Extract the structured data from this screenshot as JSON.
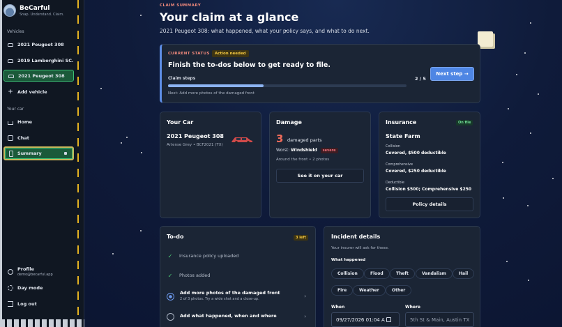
{
  "sidebar": {
    "brand": {
      "name": "BeCarful",
      "tagline": "Snap. Understand. Claim."
    },
    "vehicles_label": "Vehicles",
    "vehicles": [
      "2021 Peugeot 308",
      "2019 Lamborghini SC...",
      "2021 Peugeot 308"
    ],
    "add_vehicle": "Add vehicle",
    "your_car_label": "Your car",
    "nav": [
      "Home",
      "Chat",
      "Summary"
    ],
    "profile": {
      "label": "Profile",
      "email": "demo@becarful.app"
    },
    "day_mode": "Day mode",
    "logout": "Log out"
  },
  "header": {
    "eyebrow": "CLAIM SUMMARY",
    "title": "Your claim at a glance",
    "subtitle": "2021 Peugeot 308: what happened, what your policy says, and what to do next."
  },
  "status": {
    "label": "CURRENT STATUS",
    "badge": "Action needed",
    "headline": "Finish the to-dos below to get ready to file.",
    "steps_label": "Claim steps",
    "steps_count": "2 / 5",
    "progress": 0.4,
    "next_text": "Next: Add more photos of the damaged front",
    "next_button": "Next step →"
  },
  "car": {
    "title": "Your Car",
    "name": "2021 Peugeot 308",
    "meta": "Artense Grey • BCF2021 (TX)"
  },
  "damage": {
    "title": "Damage",
    "count": "3",
    "parts_label": "damaged parts",
    "worst_label": "Worst:",
    "worst_part": "Windshield",
    "severity": "severe",
    "where": "Around the front • 2 photos",
    "button": "See it on your car"
  },
  "insurance": {
    "title": "Insurance",
    "badge": "On file",
    "insurer": "State Farm",
    "coverages": [
      {
        "label": "Collision",
        "value": "Covered, $500 deductible"
      },
      {
        "label": "Comprehensive",
        "value": "Covered, $250 deductible"
      },
      {
        "label": "Deductible",
        "value": "Collision $500; Comprehensive $250"
      }
    ],
    "button": "Policy details"
  },
  "todo": {
    "title": "To-do",
    "badge": "3 left",
    "items": [
      {
        "label": "Insurance policy uploaded",
        "sub": ""
      },
      {
        "label": "Photos added",
        "sub": ""
      },
      {
        "label": "Add more photos of the damaged front",
        "sub": "2 of 3 photos. Try a wide shot and a close-up."
      },
      {
        "label": "Add what happened, when and where",
        "sub": ""
      }
    ]
  },
  "incident": {
    "title": "Incident details",
    "subtitle": "Your insurer will ask for these.",
    "what_label": "What happened",
    "options": [
      "Collision",
      "Flood",
      "Theft",
      "Vandalism",
      "Hail",
      "Fire",
      "Weather",
      "Other"
    ],
    "when_label": "When",
    "when_value": "09/27/2026 01:04 A",
    "where_label": "Where",
    "where_placeholder": "5th St & Main, Austin TX"
  },
  "colors": {
    "accent": "#4e86e4",
    "active_nav": "#1b5a3a",
    "danger": "#f06b5a",
    "success": "#4fd07a"
  }
}
